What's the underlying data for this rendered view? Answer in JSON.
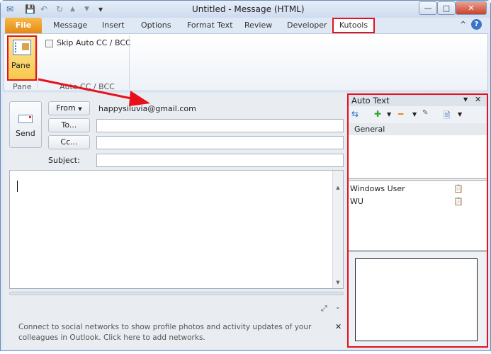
{
  "window": {
    "title": "Untitled  -  Message (HTML)",
    "minimize": "—",
    "maximize": "□",
    "close": "✕"
  },
  "quick_access": {
    "save": "💾",
    "undo": "↶",
    "redo": "↻",
    "up": "▲",
    "down": "▼",
    "customize": "▾"
  },
  "tabs": [
    {
      "label": "File"
    },
    {
      "label": "Message"
    },
    {
      "label": "Insert"
    },
    {
      "label": "Options"
    },
    {
      "label": "Format Text"
    },
    {
      "label": "Review"
    },
    {
      "label": "Developer"
    },
    {
      "label": "Kutools"
    }
  ],
  "ribbon": {
    "pane_button": "Pane",
    "pane_group": "Pane",
    "skip_checkbox": "Skip Auto CC / BCC",
    "skip_checked": false,
    "auto_cc_group": "Auto CC / BCC",
    "help": "?",
    "collapse": "^"
  },
  "compose": {
    "send": "Send",
    "from_button": "From",
    "from_value": "happysiluvia@gmail.com",
    "to_button": "To...",
    "cc_button": "Cc...",
    "subject_label": "Subject:",
    "to_value": "",
    "cc_value": "",
    "subject_value": "",
    "body": ""
  },
  "social": {
    "text_line1": "Connect to social networks to show profile photos and activity updates of your",
    "text_line2": "colleagues in Outlook. Click here to add networks.",
    "close": "✕"
  },
  "auto_text": {
    "title": "Auto Text",
    "close": "✕",
    "category": "General",
    "items": [
      {
        "name": "Windows User"
      },
      {
        "name": "WU"
      }
    ]
  },
  "colors": {
    "highlight": "#e8101a",
    "file_tab": "#e58a12"
  }
}
